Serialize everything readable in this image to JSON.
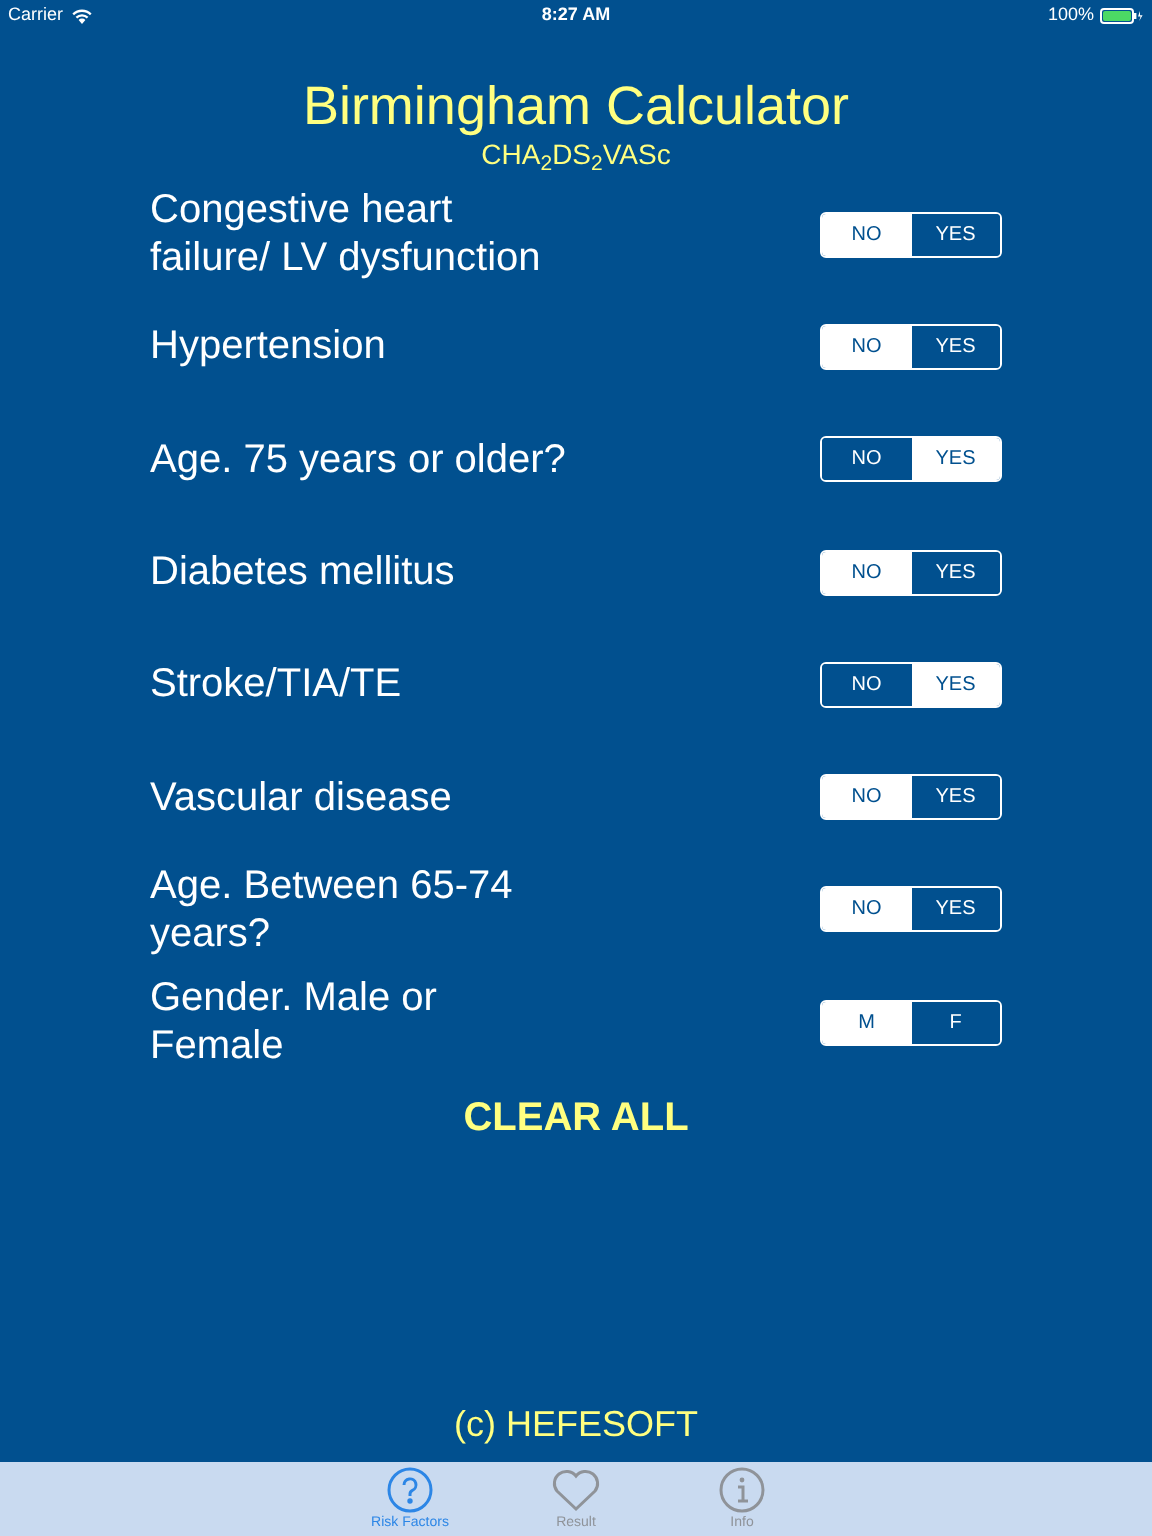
{
  "status_bar": {
    "carrier": "Carrier",
    "time": "8:27 AM",
    "battery": "100%"
  },
  "title": "Birmingham Calculator",
  "subtitle": "CHA$_{2}$DS$_{2}$VASc",
  "rows": [
    {
      "label": "Congestive heart failure/ LV dysfunction",
      "options": [
        {
          "label": "NO",
          "selected": true
        },
        {
          "label": "YES",
          "selected": false
        }
      ]
    },
    {
      "label": "Hypertension",
      "options": [
        {
          "label": "NO",
          "selected": true
        },
        {
          "label": "YES",
          "selected": false
        }
      ]
    },
    {
      "label": "Age. 75 years or older?",
      "options": [
        {
          "label": "NO",
          "selected": false
        },
        {
          "label": "YES",
          "selected": true
        }
      ]
    },
    {
      "label": "Diabetes mellitus",
      "options": [
        {
          "label": "NO",
          "selected": true
        },
        {
          "label": "YES",
          "selected": false
        }
      ]
    },
    {
      "label": "Stroke/TIA/TE",
      "options": [
        {
          "label": "NO",
          "selected": false
        },
        {
          "label": "YES",
          "selected": true
        }
      ]
    },
    {
      "label": "Vascular disease",
      "options": [
        {
          "label": "NO",
          "selected": true
        },
        {
          "label": "YES",
          "selected": false
        }
      ]
    },
    {
      "label": "Age. Between 65-74 years?",
      "options": [
        {
          "label": "NO",
          "selected": true
        },
        {
          "label": "YES",
          "selected": false
        }
      ]
    },
    {
      "label": "Gender. Male or Female",
      "options": [
        {
          "label": "M",
          "selected": true
        },
        {
          "label": "F",
          "selected": false
        }
      ]
    }
  ],
  "clear_button": "CLEAR ALL",
  "footer": "(c) HEFESOFT",
  "tabs": [
    {
      "label": "Risk Factors",
      "kind": "question",
      "selected": true
    },
    {
      "label": "Result",
      "kind": "heart",
      "selected": false
    },
    {
      "label": "Info",
      "kind": "info",
      "selected": false
    }
  ]
}
